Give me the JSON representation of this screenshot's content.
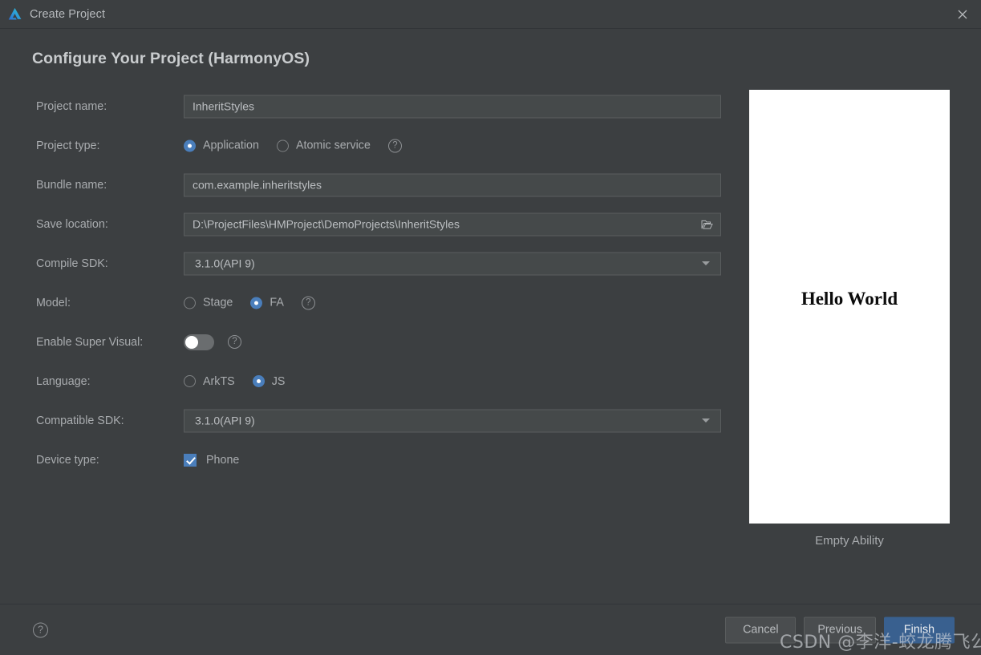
{
  "window": {
    "title": "Create Project",
    "logo_icon": "deveco-triangle-logo",
    "close_icon": "close-icon"
  },
  "heading": "Configure Your Project (HarmonyOS)",
  "form": {
    "project_name": {
      "label": "Project name:",
      "value": "InheritStyles"
    },
    "project_type": {
      "label": "Project type:",
      "options": [
        "Application",
        "Atomic service"
      ],
      "selected": "Application",
      "help_icon": "help-circle-icon"
    },
    "bundle_name": {
      "label": "Bundle name:",
      "value": "com.example.inheritstyles"
    },
    "save_location": {
      "label": "Save location:",
      "value": "D:\\ProjectFiles\\HMProject\\DemoProjects\\InheritStyles",
      "browse_icon": "folder-open-icon"
    },
    "compile_sdk": {
      "label": "Compile SDK:",
      "value": "3.1.0(API 9)",
      "arrow_icon": "chevron-down-icon"
    },
    "model": {
      "label": "Model:",
      "options": [
        "Stage",
        "FA"
      ],
      "selected": "FA",
      "help_icon": "help-circle-icon"
    },
    "super_visual": {
      "label": "Enable Super Visual:",
      "enabled": false,
      "help_icon": "help-circle-icon"
    },
    "language": {
      "label": "Language:",
      "options": [
        "ArkTS",
        "JS"
      ],
      "selected": "JS"
    },
    "compatible_sdk": {
      "label": "Compatible SDK:",
      "value": "3.1.0(API 9)",
      "arrow_icon": "chevron-down-icon"
    },
    "device_type": {
      "label": "Device type:",
      "options": [
        {
          "label": "Phone",
          "checked": true
        }
      ]
    }
  },
  "preview": {
    "screen_text": "Hello World",
    "caption": "Empty Ability"
  },
  "footer": {
    "help_icon": "help-circle-icon",
    "help_label": "?",
    "buttons": {
      "cancel": "Cancel",
      "previous": "Previous",
      "finish": "Finish"
    }
  },
  "watermark": "CSDN @李洋-蛟龙腾飞公司",
  "colors": {
    "dialog_bg": "#3c3f41",
    "input_bg": "#45494a",
    "accent_blue": "#4a7ebb",
    "primary_button": "#39608f",
    "text": "#a9acaf",
    "preview_bg": "#ffffff"
  }
}
